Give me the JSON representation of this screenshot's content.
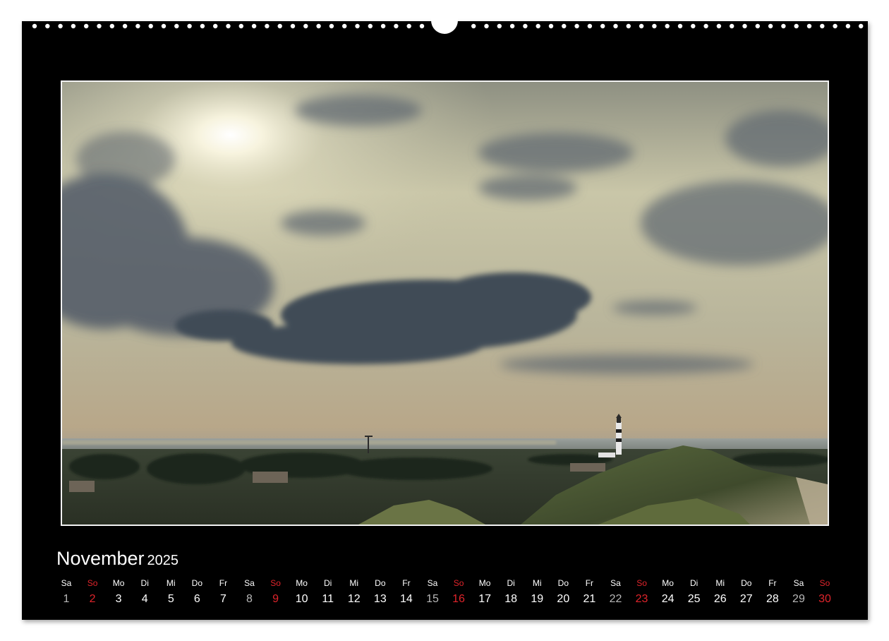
{
  "calendar": {
    "month": "November",
    "year": "2025",
    "weekend_colors": {
      "saturday": "#b8b8b8",
      "sunday": "#e0242b",
      "weekday": "#ffffff"
    },
    "days": [
      {
        "wd": "Sa",
        "n": "1"
      },
      {
        "wd": "So",
        "n": "2"
      },
      {
        "wd": "Mo",
        "n": "3"
      },
      {
        "wd": "Di",
        "n": "4"
      },
      {
        "wd": "Mi",
        "n": "5"
      },
      {
        "wd": "Do",
        "n": "6"
      },
      {
        "wd": "Fr",
        "n": "7"
      },
      {
        "wd": "Sa",
        "n": "8"
      },
      {
        "wd": "So",
        "n": "9"
      },
      {
        "wd": "Mo",
        "n": "10"
      },
      {
        "wd": "Di",
        "n": "11"
      },
      {
        "wd": "Mi",
        "n": "12"
      },
      {
        "wd": "Do",
        "n": "13"
      },
      {
        "wd": "Fr",
        "n": "14"
      },
      {
        "wd": "Sa",
        "n": "15"
      },
      {
        "wd": "So",
        "n": "16"
      },
      {
        "wd": "Mo",
        "n": "17"
      },
      {
        "wd": "Di",
        "n": "18"
      },
      {
        "wd": "Mi",
        "n": "19"
      },
      {
        "wd": "Do",
        "n": "20"
      },
      {
        "wd": "Fr",
        "n": "21"
      },
      {
        "wd": "Sa",
        "n": "22"
      },
      {
        "wd": "So",
        "n": "23"
      },
      {
        "wd": "Mo",
        "n": "24"
      },
      {
        "wd": "Di",
        "n": "25"
      },
      {
        "wd": "Mi",
        "n": "26"
      },
      {
        "wd": "Do",
        "n": "27"
      },
      {
        "wd": "Fr",
        "n": "28"
      },
      {
        "wd": "Sa",
        "n": "29"
      },
      {
        "wd": "So",
        "n": "30"
      }
    ]
  },
  "photo": {
    "subject": "dune-landscape-with-lighthouse-under-cloudy-sky"
  }
}
